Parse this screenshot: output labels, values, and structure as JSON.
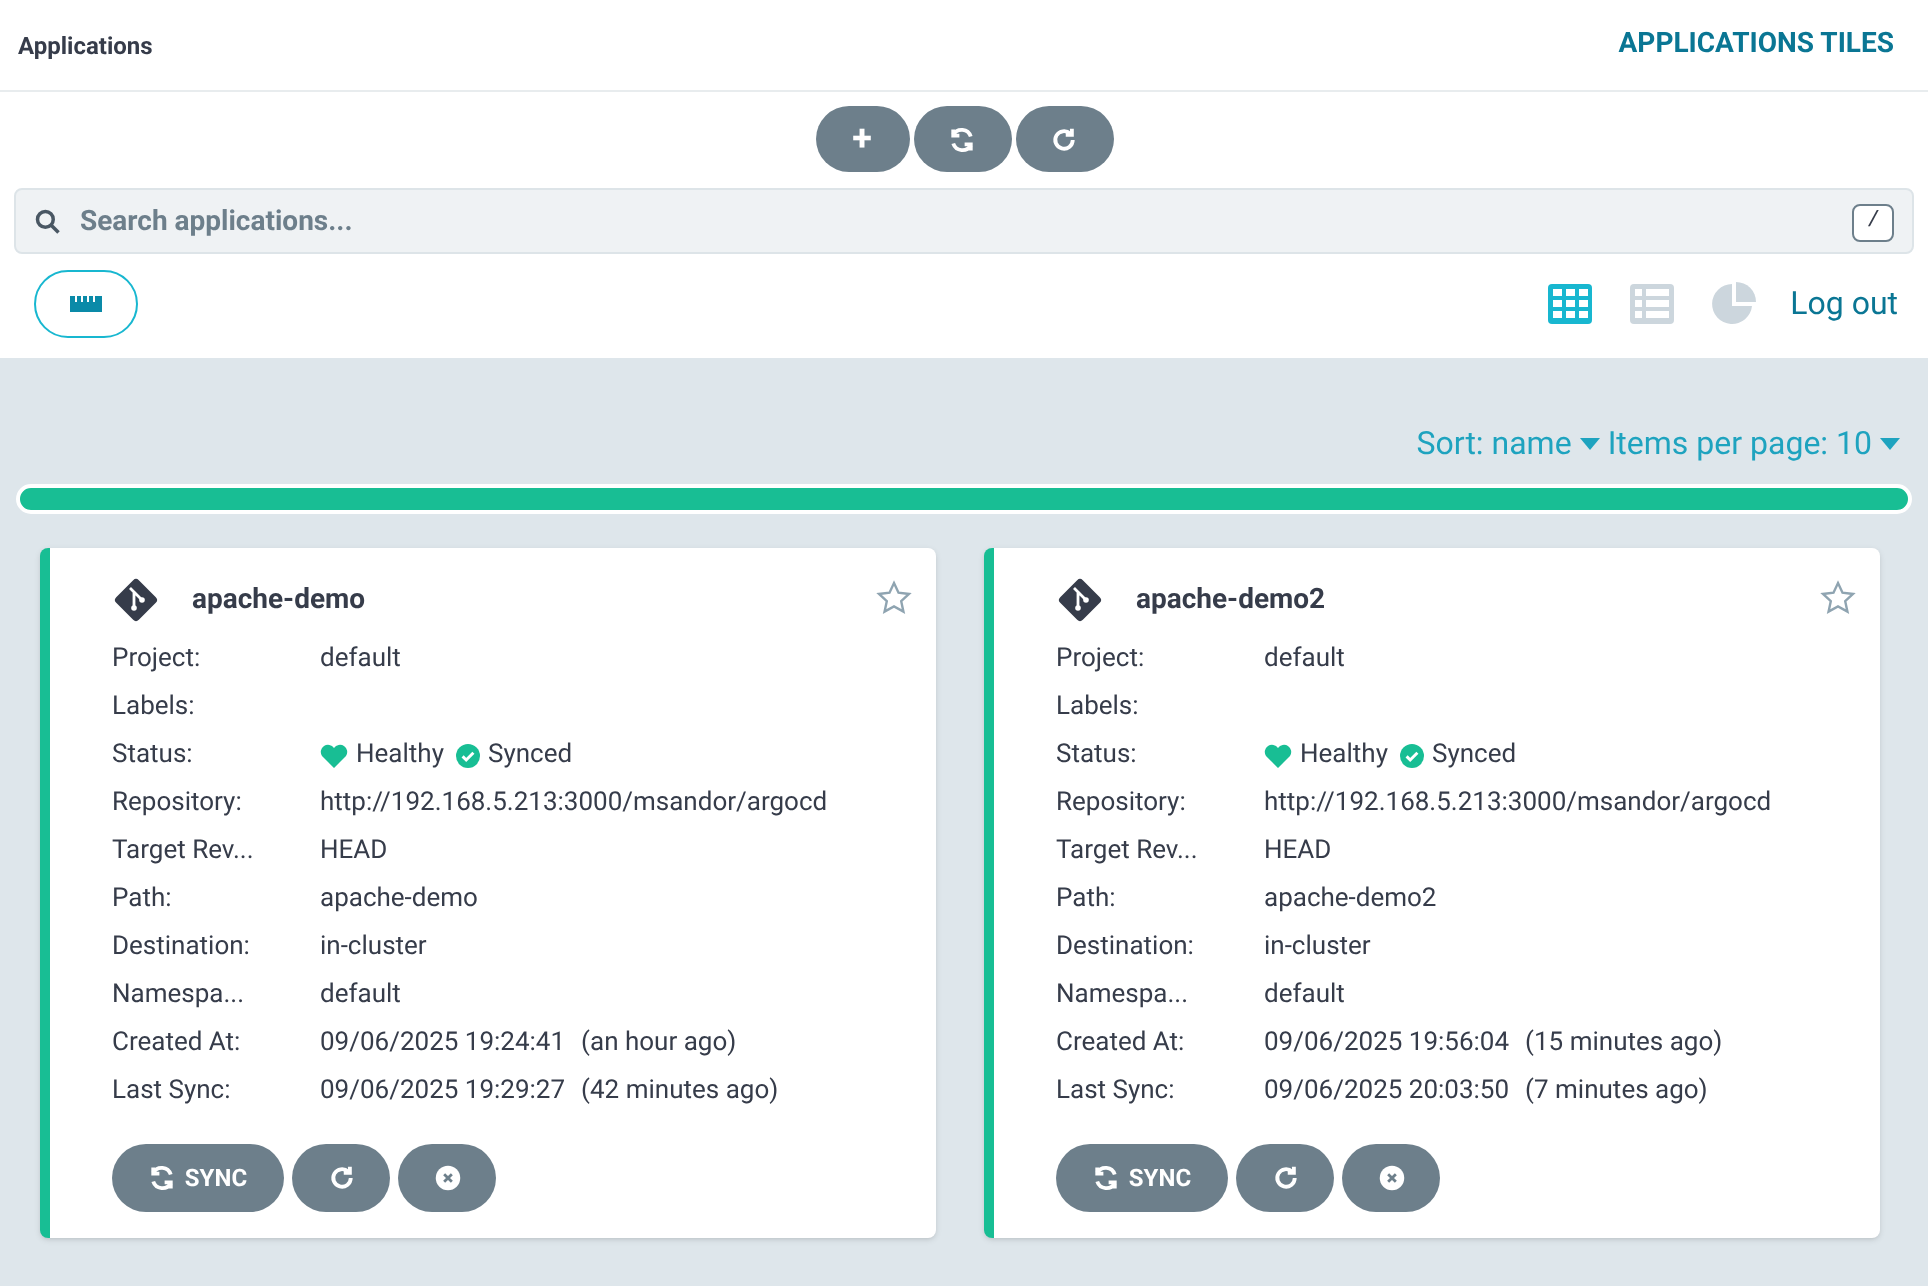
{
  "header": {
    "title": "Applications",
    "view_title": "APPLICATIONS TILES"
  },
  "toolbar": [
    "+"
  ],
  "search": {
    "placeholder": "Search applications...",
    "shortcut": "/"
  },
  "views": [
    {
      "kind": "tiles",
      "selected": true
    },
    {
      "kind": "list",
      "selected": false
    },
    {
      "kind": "summary",
      "selected": false
    }
  ],
  "logout": "Log out",
  "sort": {
    "label": "Sort: name",
    "per_page": "Items per page: 10"
  },
  "status_bar": {
    "color": "#18be94"
  },
  "apps": [
    {
      "name": "apache-demo",
      "starred": false,
      "rows": [
        {
          "kind": "text",
          "label": "Project:",
          "value": "default"
        },
        {
          "kind": "text",
          "label": "Labels:"
        },
        {
          "kind": "status",
          "label": "Status:",
          "health": "Healthy",
          "sync": "Synced"
        },
        {
          "kind": "text",
          "label": "Repository:",
          "value": "http://192.168.5.213:3000/msandor/argocd"
        },
        {
          "kind": "text",
          "label": "Target Rev...",
          "value": "HEAD"
        },
        {
          "kind": "text",
          "label": "Path:",
          "value": "apache-demo"
        },
        {
          "kind": "text",
          "label": "Destination:",
          "value": "in-cluster"
        },
        {
          "kind": "text",
          "label": "Namespa...",
          "value": "default"
        },
        {
          "kind": "time",
          "label": "Created At:",
          "value": "09/06/2025 19:24:41",
          "ago": "(an hour ago)"
        },
        {
          "kind": "time",
          "label": "Last Sync:",
          "value": "09/06/2025 19:29:27",
          "ago": "(42 minutes ago)"
        }
      ],
      "sync_button": "SYNC"
    },
    {
      "name": "apache-demo2",
      "starred": false,
      "rows": [
        {
          "kind": "text",
          "label": "Project:",
          "value": "default"
        },
        {
          "kind": "text",
          "label": "Labels:"
        },
        {
          "kind": "status",
          "label": "Status:",
          "health": "Healthy",
          "sync": "Synced"
        },
        {
          "kind": "text",
          "label": "Repository:",
          "value": "http://192.168.5.213:3000/msandor/argocd"
        },
        {
          "kind": "text",
          "label": "Target Rev...",
          "value": "HEAD"
        },
        {
          "kind": "text",
          "label": "Path:",
          "value": "apache-demo2"
        },
        {
          "kind": "text",
          "label": "Destination:",
          "value": "in-cluster"
        },
        {
          "kind": "text",
          "label": "Namespa...",
          "value": "default"
        },
        {
          "kind": "time",
          "label": "Created At:",
          "value": "09/06/2025 19:56:04",
          "ago": "(15 minutes ago)"
        },
        {
          "kind": "time",
          "label": "Last Sync:",
          "value": "09/06/2025 20:03:50",
          "ago": "(7 minutes ago)"
        }
      ],
      "sync_button": "SYNC"
    }
  ]
}
